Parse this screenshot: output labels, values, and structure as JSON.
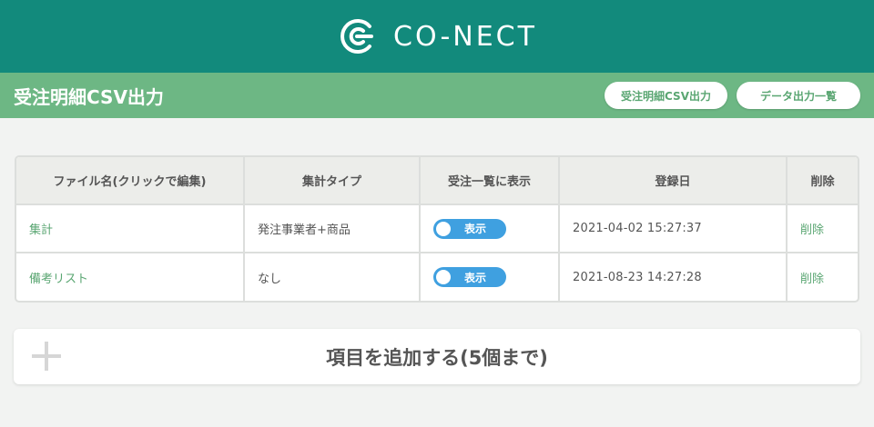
{
  "header": {
    "brand": "CO-NECT"
  },
  "subheader": {
    "title": "受注明細CSV出力",
    "buttons": {
      "csv_export": "受注明細CSV出力",
      "export_list": "データ出力一覧"
    }
  },
  "table": {
    "columns": [
      "ファイル名(クリックで編集)",
      "集計タイプ",
      "受注一覧に表示",
      "登録日",
      "削除"
    ],
    "rows": [
      {
        "file_name": "集計",
        "type": "発注事業者+商品",
        "display": "表示",
        "display_on": true,
        "date": "2021-04-02 15:27:37",
        "delete": "削除"
      },
      {
        "file_name": "備考リスト",
        "type": "なし",
        "display": "表示",
        "display_on": true,
        "date": "2021-08-23 14:27:28",
        "delete": "削除"
      }
    ]
  },
  "add_item": {
    "label": "項目を追加する(5個まで)"
  },
  "colors": {
    "brand": "#128a7c",
    "subbar": "#6db784",
    "link": "#5aa672",
    "toggle": "#3fa0e0"
  },
  "icons": {
    "logo": "conect-logo-icon",
    "add": "plus-icon"
  }
}
